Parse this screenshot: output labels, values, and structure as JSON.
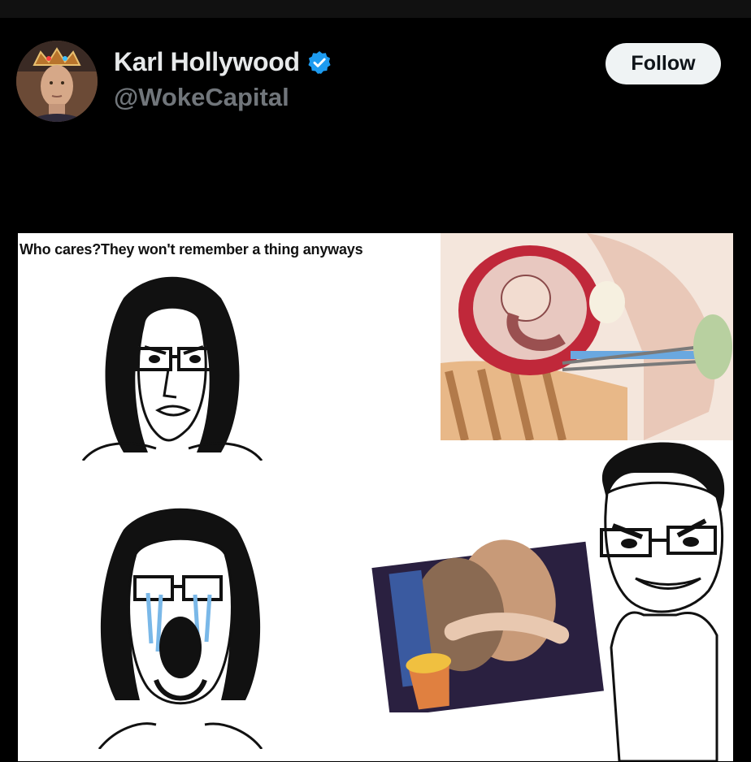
{
  "post": {
    "author": {
      "display_name": "Karl Hollywood",
      "handle": "@WokeCapital",
      "verified": true,
      "avatar_icon": "avatar-photo"
    },
    "follow_label": "Follow"
  },
  "meme": {
    "caption": "Who cares?They won't remember a thing anyways"
  },
  "colors": {
    "background": "#000000",
    "verified_badge": "#1d9bf0",
    "follow_button_bg": "#eff3f4",
    "handle_text": "#71767b"
  }
}
